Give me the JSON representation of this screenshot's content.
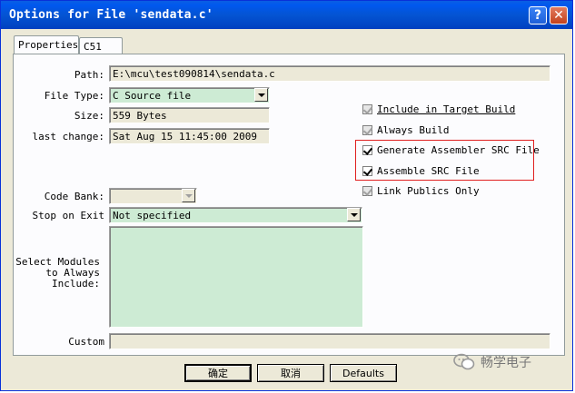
{
  "window": {
    "title": "Options for File 'sendata.c'",
    "help_symbol": "?",
    "close_symbol": "✕"
  },
  "tabs": [
    {
      "label": "Properties",
      "active": true
    },
    {
      "label": "C51",
      "active": false
    }
  ],
  "form": {
    "path_label": "Path:",
    "path_value": "E:\\mcu\\test090814\\sendata.c",
    "file_type_label": "File Type:",
    "file_type_value": "C Source file",
    "size_label": "Size:",
    "size_value": "559 Bytes",
    "last_change_label": "last change:",
    "last_change_value": "Sat Aug 15 11:45:00 2009",
    "code_bank_label": "Code Bank:",
    "code_bank_value": "",
    "stop_on_exit_label": "Stop on Exit",
    "stop_on_exit_value": "Not specified",
    "modules_label_line1": "Select Modules",
    "modules_label_line2": "to Always",
    "modules_label_line3": "Include:",
    "custom_label": "Custom",
    "custom_value": ""
  },
  "checkboxes": [
    {
      "label": "Include in Target Build",
      "checked": true,
      "enabled": false
    },
    {
      "label": "Always Build",
      "checked": true,
      "enabled": false
    },
    {
      "label": "Generate Assembler SRC File",
      "checked": true,
      "enabled": true
    },
    {
      "label": "Assemble SRC File",
      "checked": true,
      "enabled": true
    },
    {
      "label": "Link Publics Only",
      "checked": true,
      "enabled": false
    }
  ],
  "buttons": {
    "ok_label": "确定",
    "cancel_label": "取消",
    "defaults_label": "Defaults"
  },
  "watermark": {
    "text": "畅学电子"
  },
  "colors": {
    "titlebar": "#0454d3",
    "field_green": "#cdebd4",
    "highlight_box": "#e02020"
  }
}
